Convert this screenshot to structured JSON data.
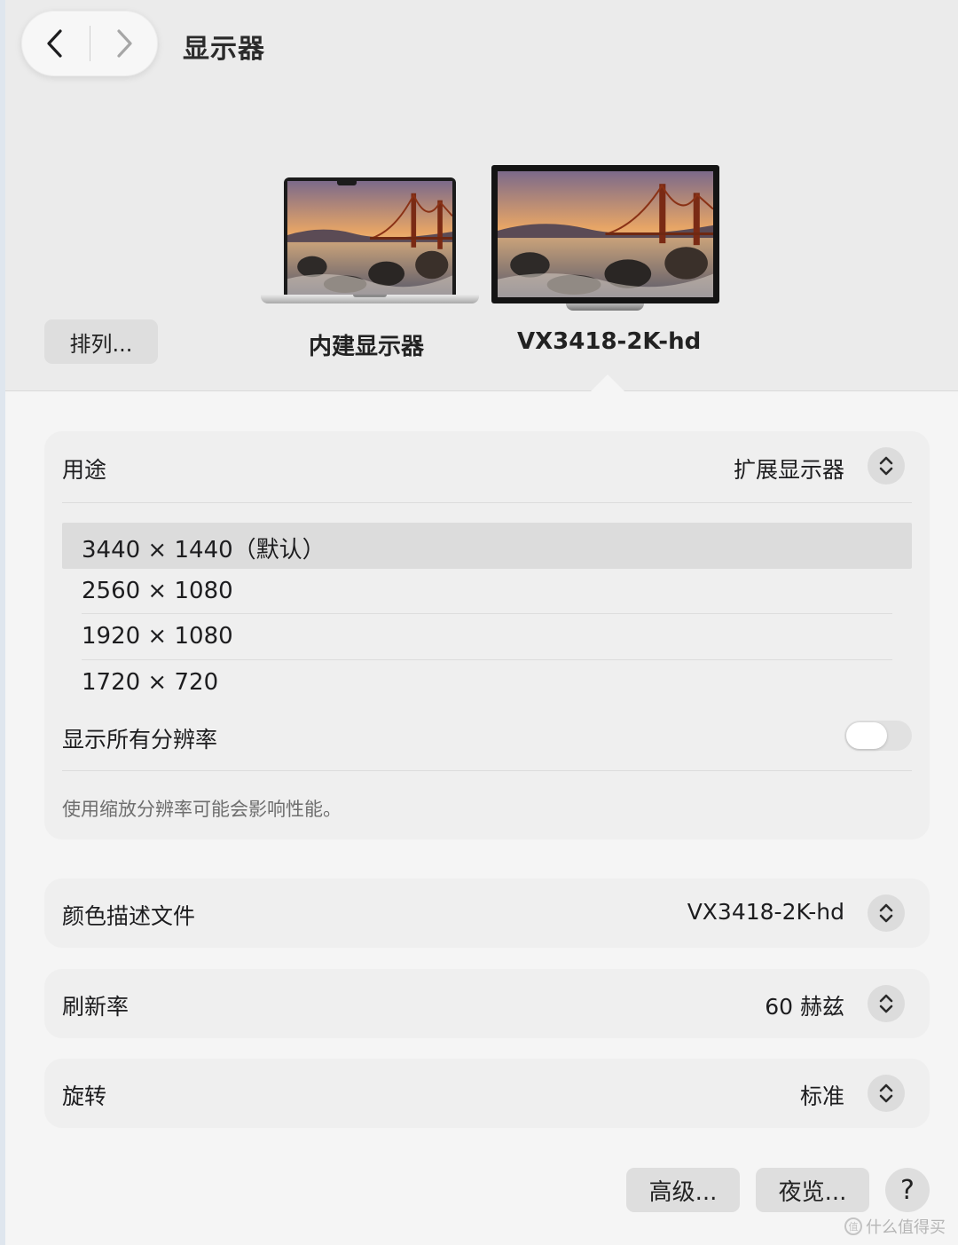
{
  "header": {
    "title": "显示器"
  },
  "displays": {
    "arrange_button": "排列...",
    "builtin_label": "内建显示器",
    "external_label": "VX3418-2K-hd"
  },
  "usage": {
    "label": "用途",
    "value": "扩展显示器"
  },
  "resolutions": {
    "items": [
      {
        "label": "3440 × 1440（默认）",
        "selected": true
      },
      {
        "label": "2560 × 1080",
        "selected": false
      },
      {
        "label": "1920 × 1080",
        "selected": false
      },
      {
        "label": "1720 × 720",
        "selected": false
      }
    ],
    "show_all_label": "显示所有分辨率",
    "show_all_enabled": false,
    "footnote": "使用缩放分辨率可能会影响性能。"
  },
  "color_profile": {
    "label": "颜色描述文件",
    "value": "VX3418-2K-hd"
  },
  "refresh_rate": {
    "label": "刷新率",
    "value": "60 赫兹"
  },
  "rotation": {
    "label": "旋转",
    "value": "标准"
  },
  "footer": {
    "advanced_button": "高级...",
    "night_shift_button": "夜览...",
    "help_button": "?"
  },
  "watermark": {
    "text": "什么值得买"
  },
  "icons": {
    "back": "chevron-left-icon",
    "forward": "chevron-right-icon",
    "stepper": "up-down-chevron-icon"
  }
}
